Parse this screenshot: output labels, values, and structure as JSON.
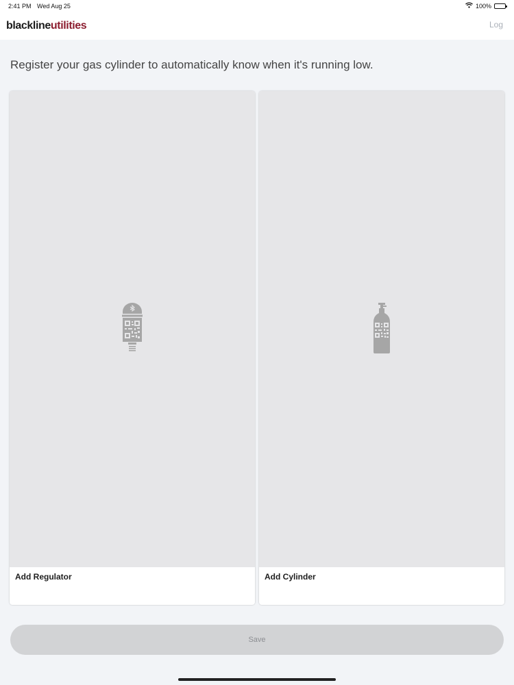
{
  "status_bar": {
    "time": "2:41 PM",
    "date": "Wed Aug 25",
    "battery": "100%",
    "icons": [
      "wifi-icon",
      "battery-icon"
    ]
  },
  "header": {
    "logo_part1": "blackline",
    "logo_part2": "utilities",
    "log_link": "Log",
    "colors": {
      "logo_dark": "#1a1a1a",
      "logo_accent": "#8c1d2f"
    }
  },
  "intro_text": "Register your gas cylinder to automatically know when it's running low.",
  "cards": [
    {
      "label": "Add Regulator",
      "icon": "regulator-qr-icon"
    },
    {
      "label": "Add Cylinder",
      "icon": "cylinder-qr-icon"
    }
  ],
  "save_button": {
    "label": "Save",
    "enabled": false
  }
}
